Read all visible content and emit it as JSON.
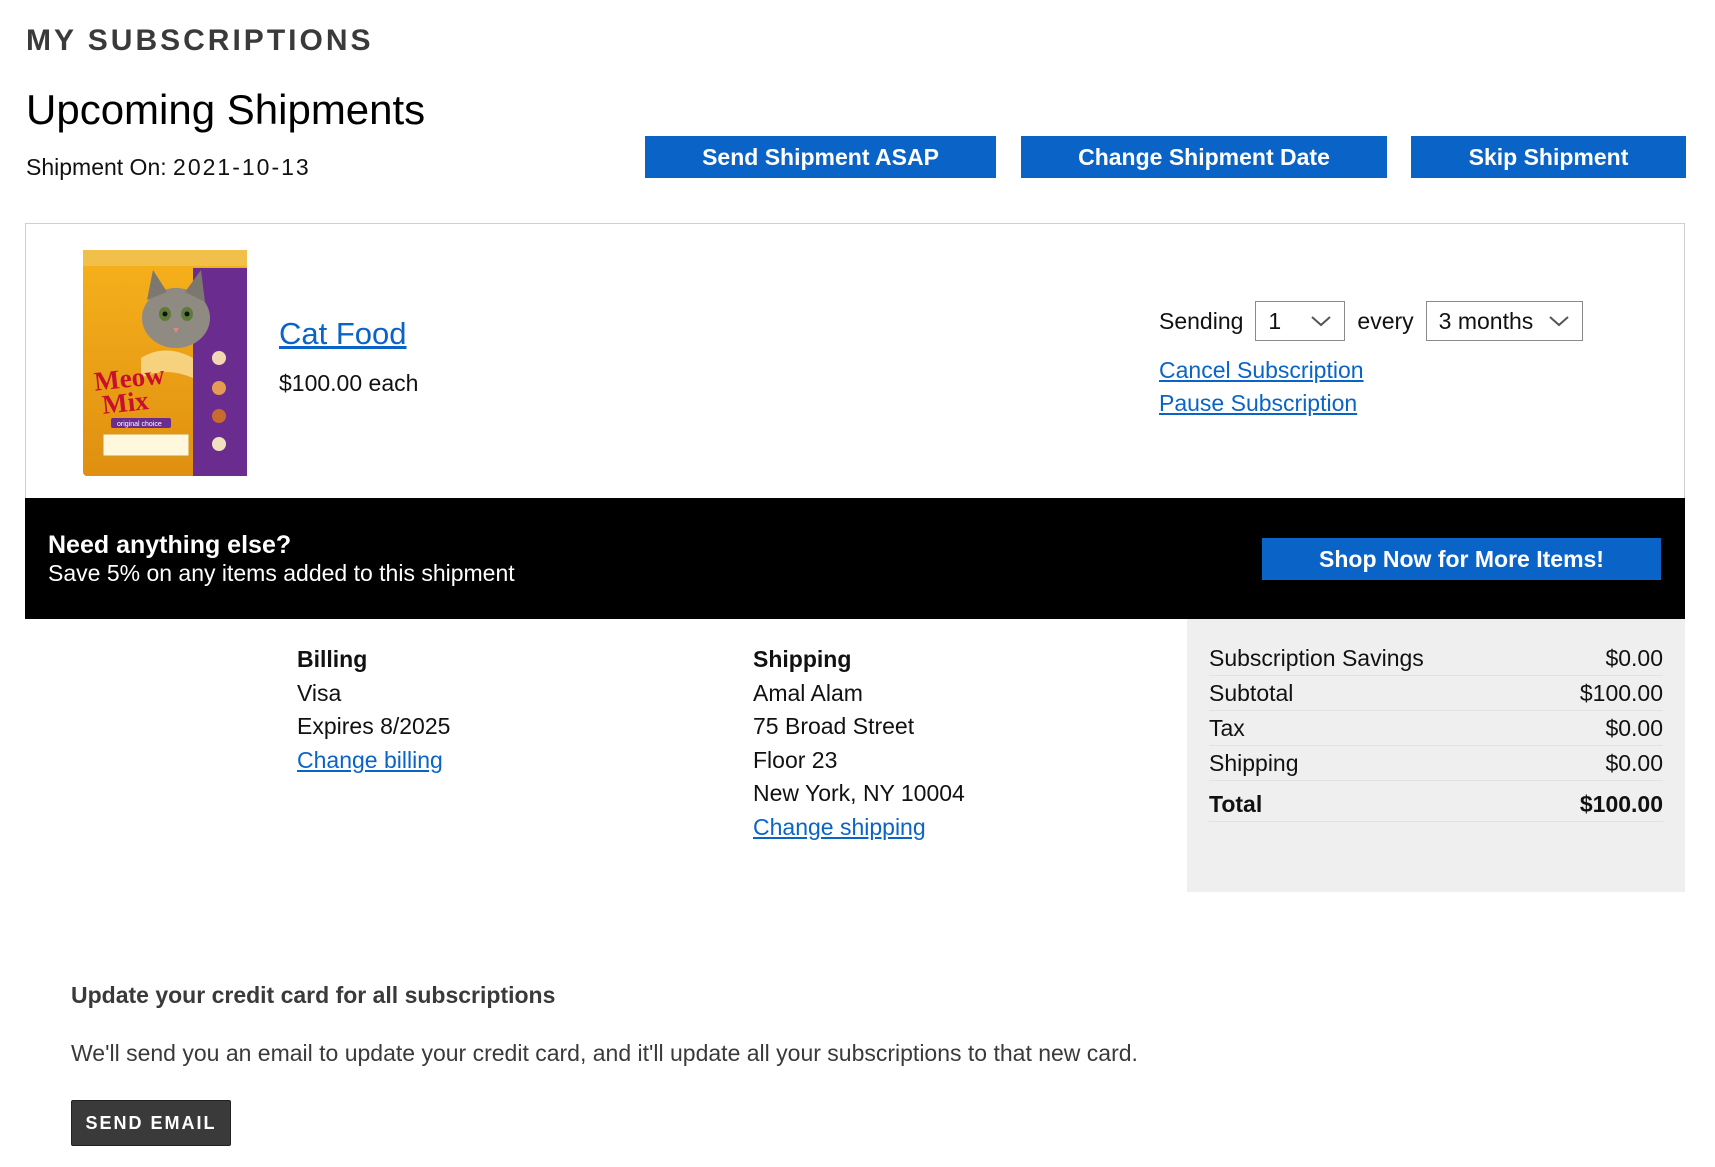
{
  "header": {
    "page_heading": "MY SUBSCRIPTIONS",
    "section_title": "Upcoming Shipments",
    "shipment_on_label": "Shipment On:",
    "shipment_date": "2021-10-13"
  },
  "actions": {
    "send_asap": "Send Shipment ASAP",
    "change_date": "Change Shipment Date",
    "skip": "Skip Shipment"
  },
  "item": {
    "name": "Cat Food",
    "price": "$100.00 each",
    "image_brand": "Meow Mix",
    "image_variant": "original choice",
    "sending_label": "Sending",
    "quantity": "1",
    "every_label": "every",
    "frequency": "3 months",
    "cancel_link": "Cancel Subscription",
    "pause_link": "Pause Subscription"
  },
  "promo": {
    "title": "Need anything else?",
    "subtitle": "Save 5% on any items added to this shipment",
    "button": "Shop Now for More Items!"
  },
  "billing": {
    "label": "Billing",
    "card": "Visa",
    "expires": "Expires 8/2025",
    "change_link": "Change billing"
  },
  "shipping": {
    "label": "Shipping",
    "name": "Amal Alam",
    "street": "75 Broad Street",
    "floor": "Floor 23",
    "city": "New York, NY 10004",
    "change_link": "Change shipping"
  },
  "totals": {
    "rows": [
      {
        "label": "Subscription Savings",
        "value": "$0.00"
      },
      {
        "label": "Subtotal",
        "value": "$100.00"
      },
      {
        "label": "Tax",
        "value": "$0.00"
      },
      {
        "label": "Shipping",
        "value": "$0.00"
      }
    ],
    "total_label": "Total",
    "total_value": "$100.00"
  },
  "credit_card": {
    "title": "Update your credit card for all subscriptions",
    "description": "We'll send you an email to update your credit card, and it'll update all your subscriptions to that new card.",
    "button": "SEND EMAIL"
  },
  "colors": {
    "primary_blue": "#0a64c8",
    "promo_bg": "#000000",
    "dark_button": "#3a3a3a",
    "totals_bg": "#efefef"
  }
}
